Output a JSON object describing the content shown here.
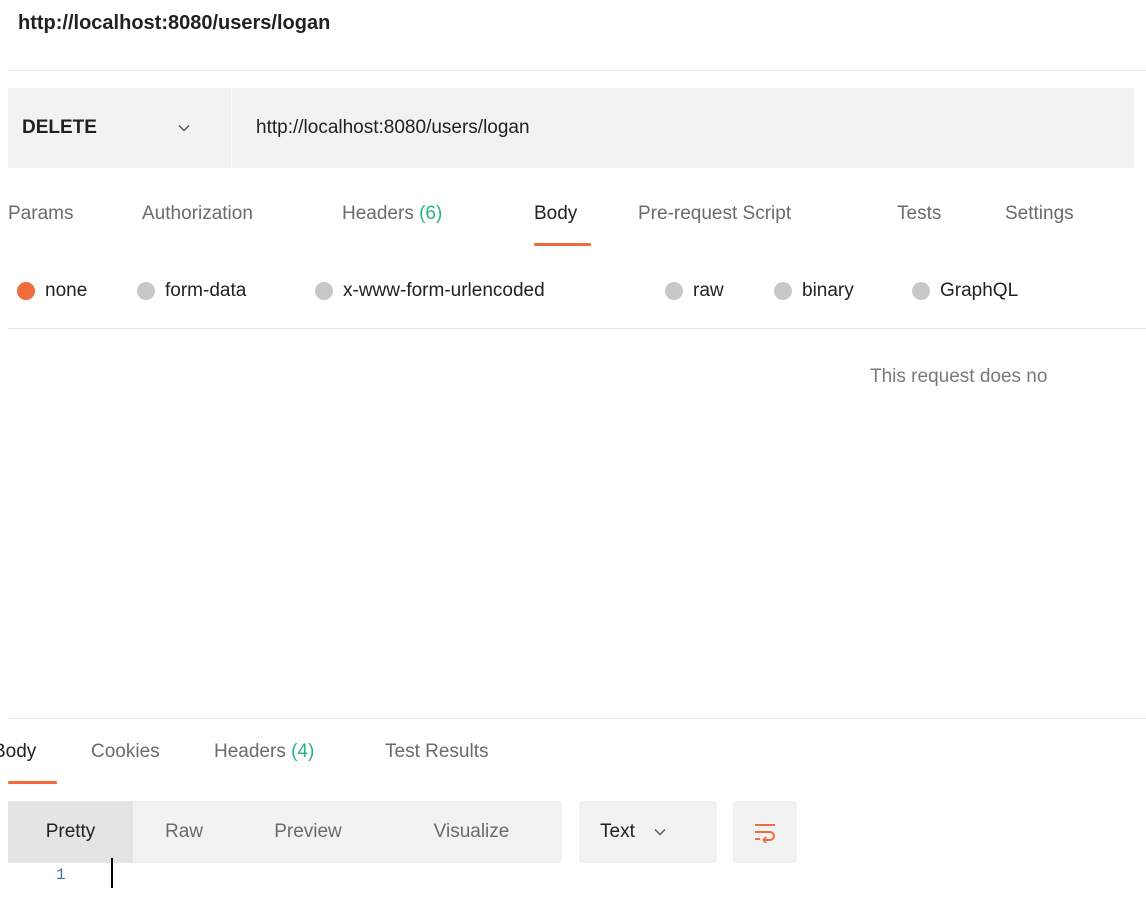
{
  "request": {
    "title": "http://localhost:8080/users/logan",
    "method": "DELETE",
    "url": "http://localhost:8080/users/logan"
  },
  "request_tabs": {
    "params": "Params",
    "authorization": "Authorization",
    "headers_label": "Headers",
    "headers_count": "(6)",
    "body": "Body",
    "pre_request": "Pre-request Script",
    "tests": "Tests",
    "settings": "Settings",
    "active": "Body"
  },
  "body_types": {
    "selected": "none",
    "options": [
      "none",
      "form-data",
      "x-www-form-urlencoded",
      "raw",
      "binary",
      "GraphQL"
    ]
  },
  "body_empty_message": "This request does no",
  "response_tabs": {
    "body": "Body",
    "cookies": "Cookies",
    "headers_label": "Headers",
    "headers_count": "(4)",
    "test_results": "Test Results",
    "active": "Body"
  },
  "response_format": {
    "buttons": [
      "Pretty",
      "Raw",
      "Preview",
      "Visualize"
    ],
    "active": "Pretty",
    "language": "Text"
  },
  "editor": {
    "line_numbers": [
      "1"
    ]
  },
  "colors": {
    "accent": "#f26b3a",
    "count_green": "#26b47f",
    "radio_inactive": "#c8c8c8",
    "panel_bg": "#f2f2f2"
  },
  "icons": {
    "method_dropdown": "chevron-down-icon",
    "language_dropdown": "chevron-down-icon",
    "wrap_toggle": "wrap-lines-icon"
  }
}
